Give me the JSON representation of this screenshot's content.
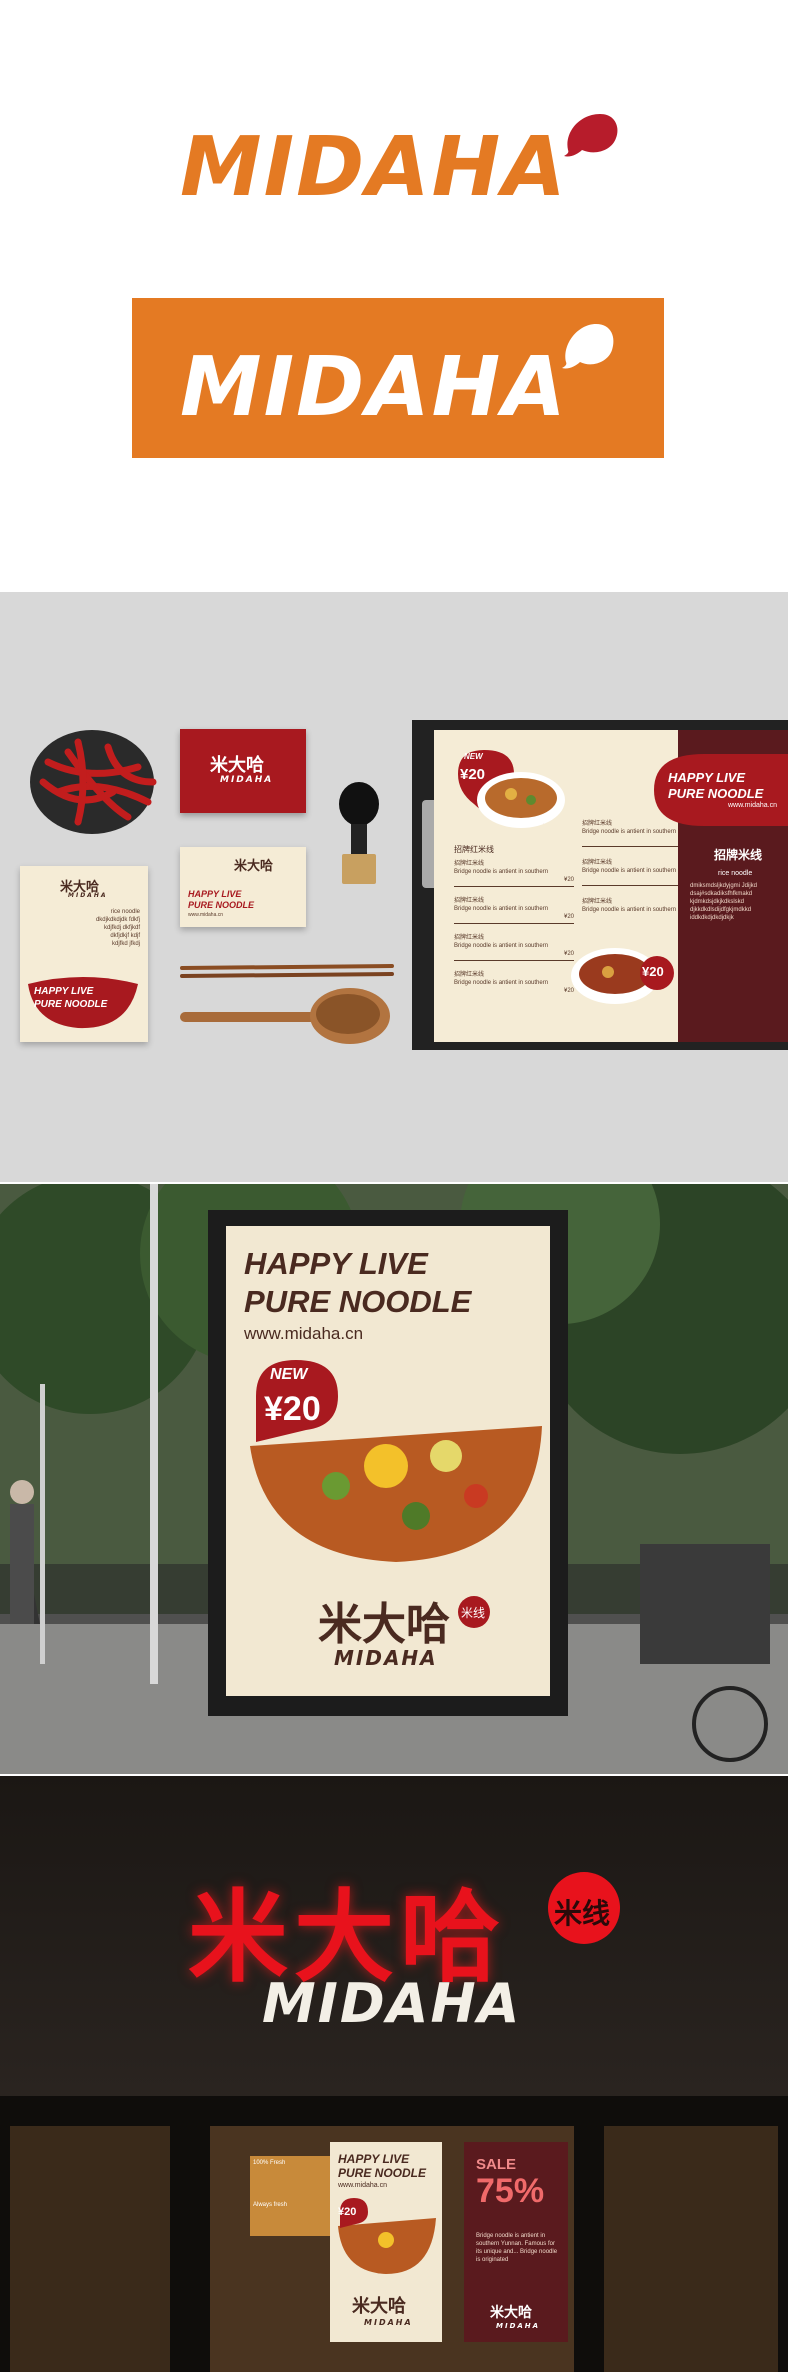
{
  "brand": {
    "name_en": "MIDAHA",
    "name_cn": "米大哈",
    "tag_cn": "米线",
    "slogan_line1": "HAPPY LIVE",
    "slogan_line2": "PURE NOODLE",
    "slogan_oneline": "HAPPY LIVE PURE NOODLE",
    "website": "www.midaha.cn",
    "colors": {
      "orange": "#e47a23",
      "red": "#a8191f",
      "dark_red": "#5a1a1e",
      "cream": "#f5ecd6",
      "brown": "#4a2a20"
    }
  },
  "offer": {
    "badge": "NEW",
    "price": "¥20"
  },
  "menu": {
    "section_title": "招牌红米线",
    "signature_title": "招牌米线",
    "item_label": "招牌红米线",
    "item_desc": "Bridge noodle is antient in southern",
    "item_price": "¥20",
    "side_title": "rice noodle",
    "side_lines": [
      "dmiksmdsljkdyjgmi Jdijkd",
      "dsaj#sdkadiksfhfkmakd",
      "kjdmkdsjdkjkdkslskd",
      "djkkdkdlsdijdfgkjmdkkd",
      "iddkdkdjdkdjdkjk"
    ]
  },
  "letterhead": {
    "lines": [
      "rice noodle",
      "dkdjkdkdjdk fdkfj",
      "kdjfkdj dkfjkdf",
      "dkfjdkjf kdjf",
      "kdjfkd jfkdj"
    ]
  },
  "storefront": {
    "poster_left": {
      "slogan1": "HAPPY LIVE",
      "slogan2": "PURE NOODLE",
      "website": "www.midaha.cn"
    },
    "poster_right": {
      "sale": "SALE",
      "percent": "75%",
      "body": "Bridge noodle is antient in southern Yunnan. Famous for its unique and... Bridge noodle is originated"
    },
    "window_label1": "100% Fresh",
    "window_label2": "Always fresh"
  }
}
